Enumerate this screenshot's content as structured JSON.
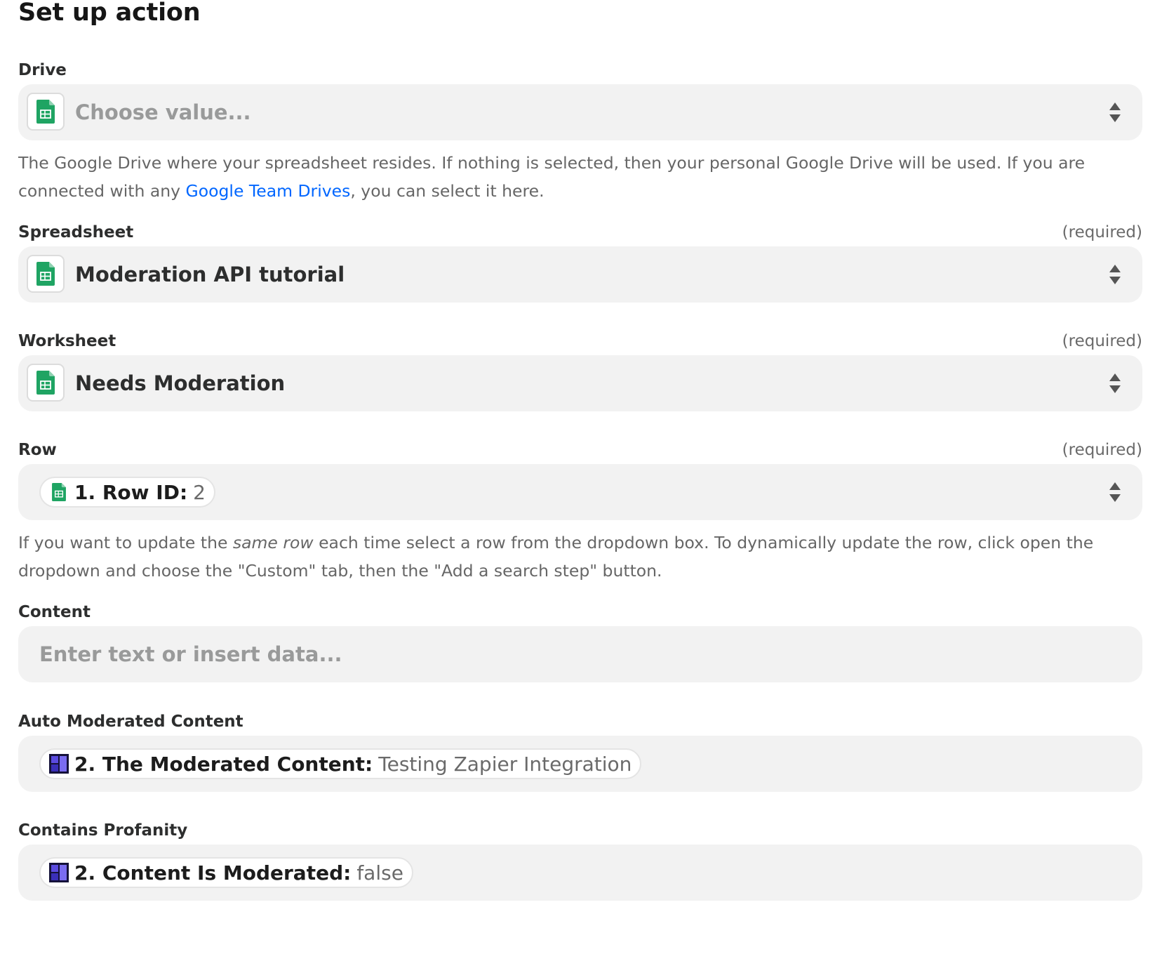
{
  "page": {
    "title": "Set up action"
  },
  "colors": {
    "sheets_green": "#1fa463",
    "link_blue": "#0066ff",
    "moderation_purple": "#3b2aa6"
  },
  "fields": {
    "drive": {
      "label": "Drive",
      "placeholder": "Choose value...",
      "help_before": "The Google Drive where your spreadsheet resides. If nothing is selected, then your personal Google Drive will be used. If you are connected with any ",
      "help_link": "Google Team Drives",
      "help_after": ", you can select it here.",
      "icon": "google-sheets-icon"
    },
    "spreadsheet": {
      "label": "Spreadsheet",
      "required": "(required)",
      "value": "Moderation API tutorial",
      "icon": "google-sheets-icon"
    },
    "worksheet": {
      "label": "Worksheet",
      "required": "(required)",
      "value": "Needs Moderation",
      "icon": "google-sheets-icon"
    },
    "row": {
      "label": "Row",
      "required": "(required)",
      "pill_key": "1. Row ID:",
      "pill_value": "2",
      "help_before": "If you want to update the ",
      "help_em": "same row",
      "help_after": " each time select a row from the dropdown box. To dynamically update the row, click open the dropdown and choose the \"Custom\" tab, then the \"Add a search step\" button.",
      "icon": "google-sheets-icon"
    },
    "content": {
      "label": "Content",
      "placeholder": "Enter text or insert data..."
    },
    "auto_moderated": {
      "label": "Auto Moderated Content",
      "pill_key": "2. The Moderated Content:",
      "pill_value": "Testing Zapier Integration",
      "icon": "moderation-api-icon"
    },
    "contains_profanity": {
      "label": "Contains Profanity",
      "pill_key": "2. Content Is Moderated:",
      "pill_value": "false",
      "icon": "moderation-api-icon"
    }
  }
}
